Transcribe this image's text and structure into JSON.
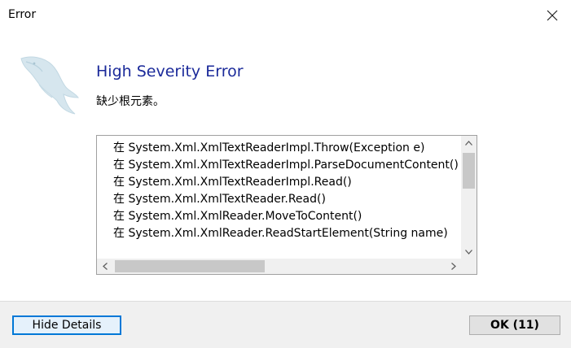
{
  "window": {
    "title": "Error",
    "close_glyph": "✕"
  },
  "dialog": {
    "heading": "High Severity Error",
    "message": "缺少根元素。",
    "logo_icon": "mysql-dolphin-icon",
    "heading_color": "#1b2a9a"
  },
  "details": {
    "lines": [
      "在 System.Xml.XmlTextReaderImpl.Throw(Exception e)",
      "在 System.Xml.XmlTextReaderImpl.ParseDocumentContent()",
      "在 System.Xml.XmlTextReaderImpl.Read()",
      "在 System.Xml.XmlTextReader.Read()",
      "在 System.Xml.XmlReader.MoveToContent()",
      "在 System.Xml.XmlReader.ReadStartElement(String name)"
    ],
    "scroll_up": "⌃",
    "scroll_down": "⌄",
    "scroll_left": "<",
    "scroll_right": ">"
  },
  "buttons": {
    "hide_details": "Hide Details",
    "ok": "OK (11)"
  }
}
